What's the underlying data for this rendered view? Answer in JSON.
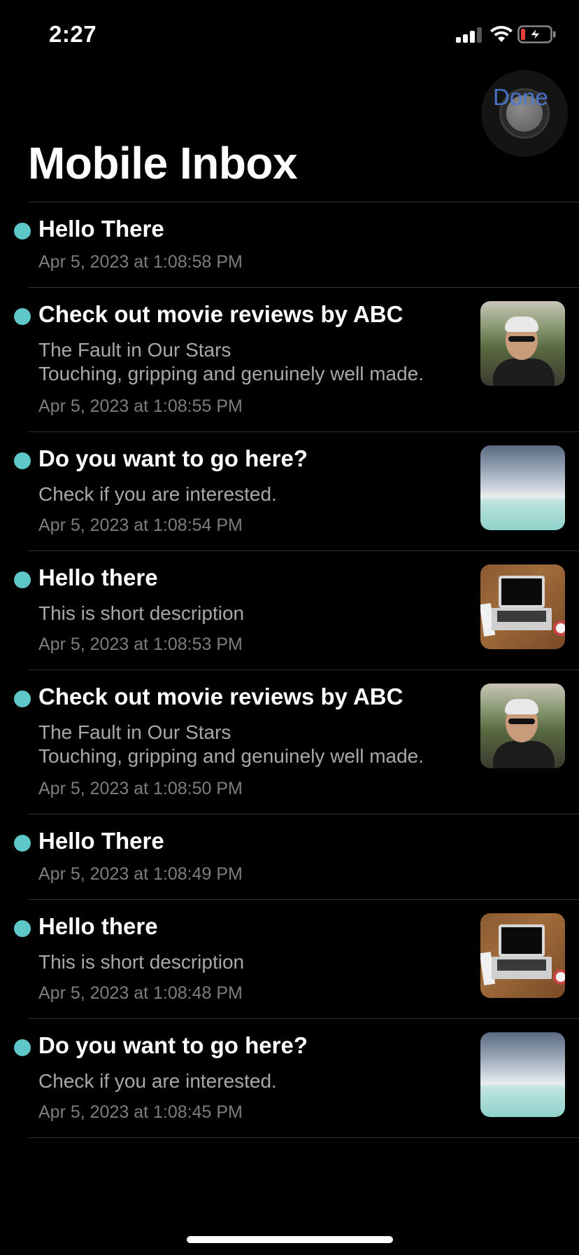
{
  "status_bar": {
    "time": "2:27",
    "icons": [
      "cellular-signal-icon",
      "wifi-icon",
      "battery-charging-icon"
    ]
  },
  "header": {
    "done_label": "Done",
    "title": "Mobile Inbox"
  },
  "colors": {
    "background": "#000000",
    "unread_dot": "#5ec7c8",
    "done_accent": "#4c7bd6",
    "secondary_text": "#a8a8a8",
    "date_text": "#7d7d7d"
  },
  "messages": [
    {
      "title": "Hello There",
      "lines": [],
      "date": "Apr 5, 2023 at 1:08:58 PM",
      "thumbnail": null,
      "unread": true
    },
    {
      "title": "Check out movie reviews by ABC",
      "lines": [
        "The Fault in Our Stars",
        "Touching, gripping and genuinely well made."
      ],
      "date": "Apr 5, 2023 at 1:08:55 PM",
      "thumbnail": "person-photo",
      "unread": true
    },
    {
      "title": "Do you want to go here?",
      "lines": [
        "Check if you are interested."
      ],
      "date": "Apr 5, 2023 at 1:08:54 PM",
      "thumbnail": "sea-photo",
      "unread": true
    },
    {
      "title": "Hello there",
      "lines": [
        "This is short description"
      ],
      "date": "Apr 5, 2023 at 1:08:53 PM",
      "thumbnail": "laptop-photo",
      "unread": true
    },
    {
      "title": "Check out movie reviews by ABC",
      "lines": [
        "The Fault in Our Stars",
        "Touching, gripping and genuinely well made."
      ],
      "date": "Apr 5, 2023 at 1:08:50 PM",
      "thumbnail": "person-photo",
      "unread": true
    },
    {
      "title": "Hello There",
      "lines": [],
      "date": "Apr 5, 2023 at 1:08:49 PM",
      "thumbnail": null,
      "unread": true
    },
    {
      "title": "Hello there",
      "lines": [
        "This is short description"
      ],
      "date": "Apr 5, 2023 at 1:08:48 PM",
      "thumbnail": "laptop-photo",
      "unread": true
    },
    {
      "title": "Do you want to go here?",
      "lines": [
        "Check if you are interested."
      ],
      "date": "Apr 5, 2023 at 1:08:45 PM",
      "thumbnail": "sea-photo",
      "unread": true
    }
  ]
}
